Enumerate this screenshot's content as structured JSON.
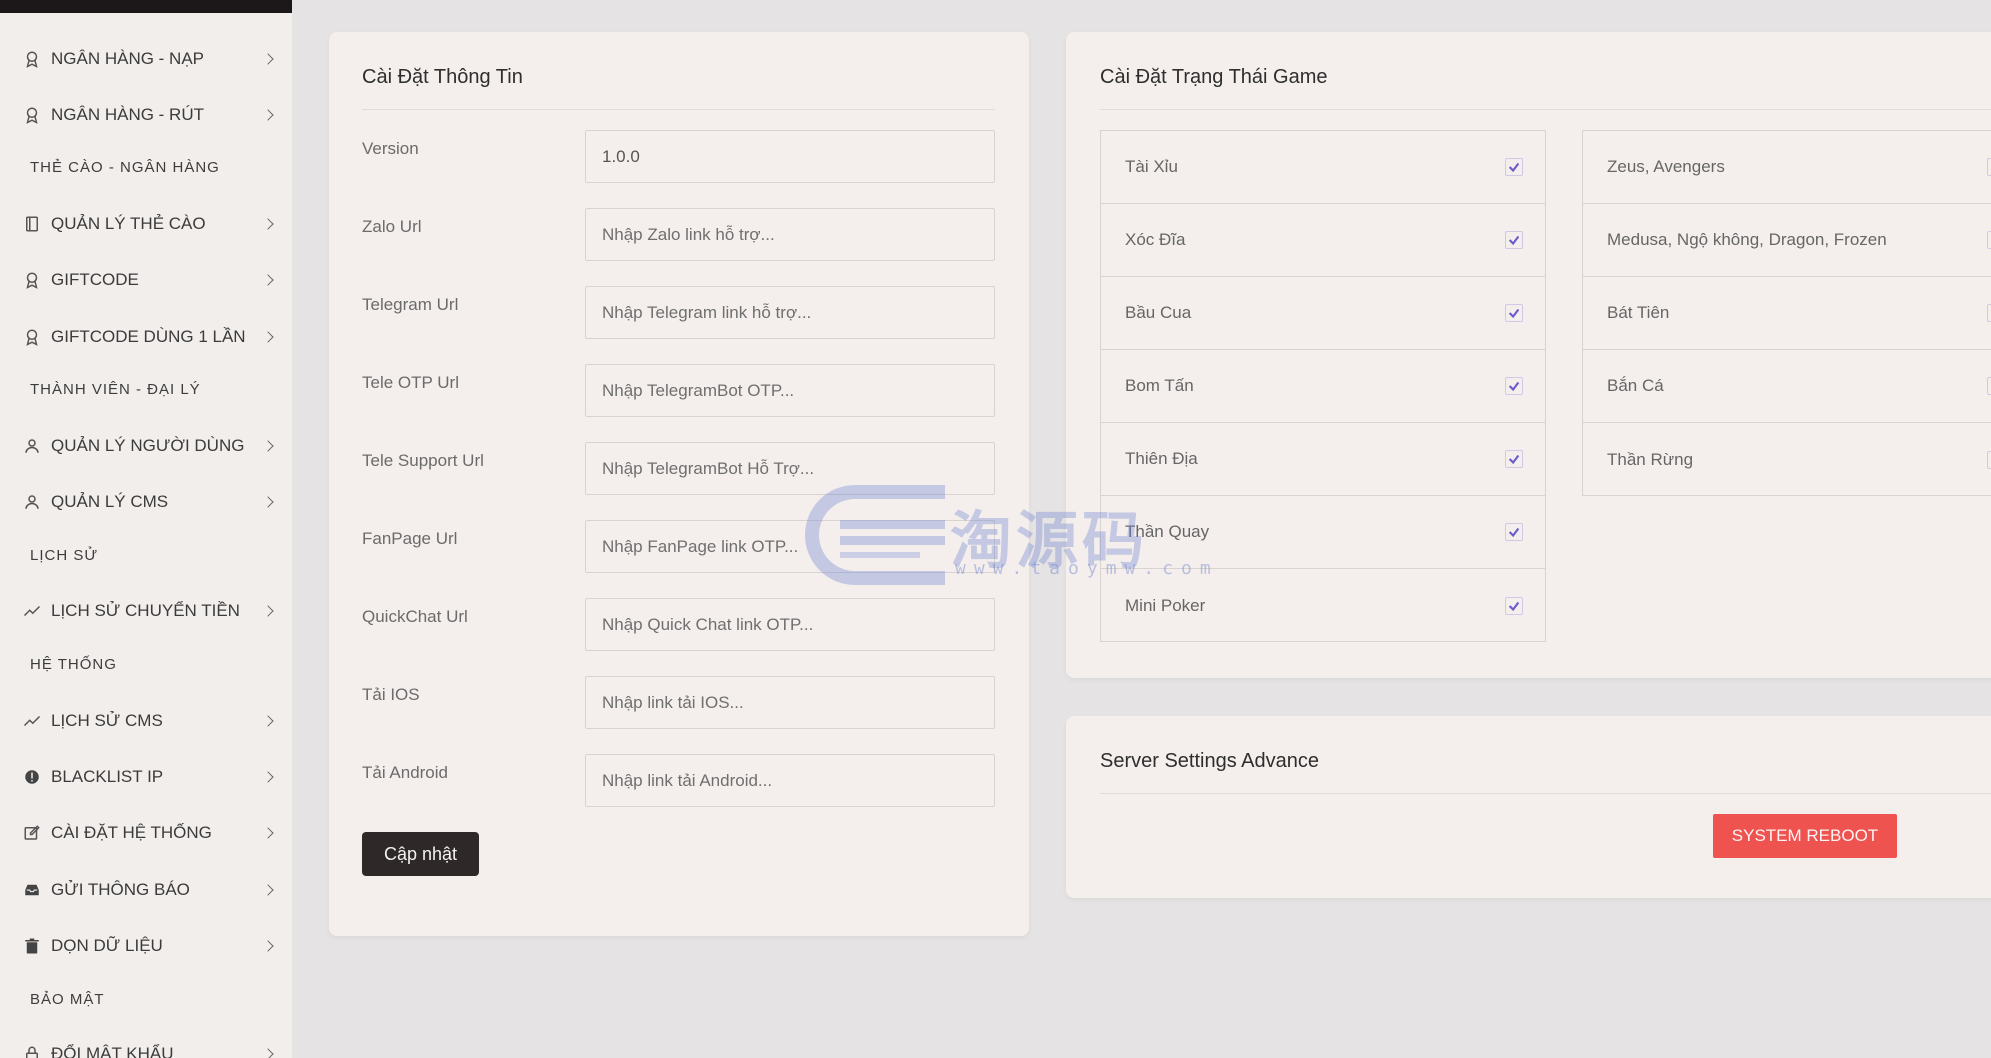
{
  "sidebar": {
    "items": [
      {
        "label": "NGÂN HÀNG - NẠP",
        "icon": "award-icon",
        "type": "item"
      },
      {
        "label": "NGÂN HÀNG - RÚT",
        "icon": "award-icon",
        "type": "item"
      },
      {
        "label": "THẺ CÀO - NGÂN HÀNG",
        "type": "header"
      },
      {
        "label": "QUẢN LÝ THẺ CÀO",
        "icon": "book-icon",
        "type": "item"
      },
      {
        "label": "GIFTCODE",
        "icon": "award-icon",
        "type": "item"
      },
      {
        "label": "GIFTCODE DÙNG 1 LẦN",
        "icon": "award-icon",
        "type": "item"
      },
      {
        "label": "THÀNH VIÊN - ĐẠI LÝ",
        "type": "header"
      },
      {
        "label": "QUẢN LÝ NGƯỜI DÙNG",
        "icon": "user-icon",
        "type": "item"
      },
      {
        "label": "QUẢN LÝ CMS",
        "icon": "user-icon",
        "type": "item"
      },
      {
        "label": "LỊCH SỬ",
        "type": "header"
      },
      {
        "label": "LỊCH SỬ CHUYỂN TIỀN",
        "icon": "trending-icon",
        "type": "item"
      },
      {
        "label": "HỆ THỐNG",
        "type": "header"
      },
      {
        "label": "LỊCH SỬ CMS",
        "icon": "trending-icon",
        "type": "item"
      },
      {
        "label": "BLACKLIST IP",
        "icon": "alert-circle-icon",
        "type": "item"
      },
      {
        "label": "CÀI ĐẶT HỆ THỐNG",
        "icon": "edit-icon",
        "type": "item"
      },
      {
        "label": "GỬI THÔNG BÁO",
        "icon": "inbox-icon",
        "type": "item"
      },
      {
        "label": "DỌN DỮ LIỆU",
        "icon": "trash-icon",
        "type": "item"
      },
      {
        "label": "BẢO MẬT",
        "type": "header"
      },
      {
        "label": "ĐỔI MẬT KHẨU",
        "icon": "lock-icon",
        "type": "item"
      }
    ]
  },
  "info_card": {
    "title": "Cài Đặt Thông Tin",
    "fields": [
      {
        "label": "Version",
        "value": "1.0.0",
        "placeholder": ""
      },
      {
        "label": "Zalo Url",
        "value": "",
        "placeholder": "Nhập Zalo link hỗ trợ..."
      },
      {
        "label": "Telegram Url",
        "value": "",
        "placeholder": "Nhập Telegram link hỗ trợ..."
      },
      {
        "label": "Tele OTP Url",
        "value": "",
        "placeholder": "Nhập TelegramBot OTP..."
      },
      {
        "label": "Tele Support Url",
        "value": "",
        "placeholder": "Nhập TelegramBot Hỗ Trợ..."
      },
      {
        "label": "FanPage Url",
        "value": "",
        "placeholder": "Nhập FanPage link OTP..."
      },
      {
        "label": "QuickChat Url",
        "value": "",
        "placeholder": "Nhập Quick Chat link OTP..."
      },
      {
        "label": "Tải IOS",
        "value": "",
        "placeholder": "Nhập link tải IOS..."
      },
      {
        "label": "Tải Android",
        "value": "",
        "placeholder": "Nhập link tải Android..."
      }
    ],
    "submit_label": "Cập nhật"
  },
  "game_card": {
    "title": "Cài Đặt Trạng Thái Game",
    "left_games": [
      {
        "name": "Tài Xỉu",
        "checked": true
      },
      {
        "name": "Xóc Đĩa",
        "checked": true
      },
      {
        "name": "Bầu Cua",
        "checked": true
      },
      {
        "name": "Bom Tấn",
        "checked": true
      },
      {
        "name": "Thiên Địa",
        "checked": true
      },
      {
        "name": "Thần Quay",
        "checked": true
      },
      {
        "name": "Mini Poker",
        "checked": true
      }
    ],
    "right_games": [
      {
        "name": "Zeus, Avengers",
        "checked": true
      },
      {
        "name": "Medusa, Ngộ không, Dragon, Frozen",
        "checked": true
      },
      {
        "name": "Bát Tiên",
        "checked": true
      },
      {
        "name": "Bắn Cá",
        "checked": true
      },
      {
        "name": "Thần Rừng",
        "checked": true
      }
    ]
  },
  "server_card": {
    "title": "Server Settings Advance",
    "reboot_label": "SYSTEM REBOOT"
  },
  "watermark": {
    "text": "淘源码",
    "sub": "www.taoymw.com"
  },
  "colors": {
    "accent_check": "#6a5acd",
    "reboot": "#ef5350",
    "update_button": "#2f2828"
  }
}
